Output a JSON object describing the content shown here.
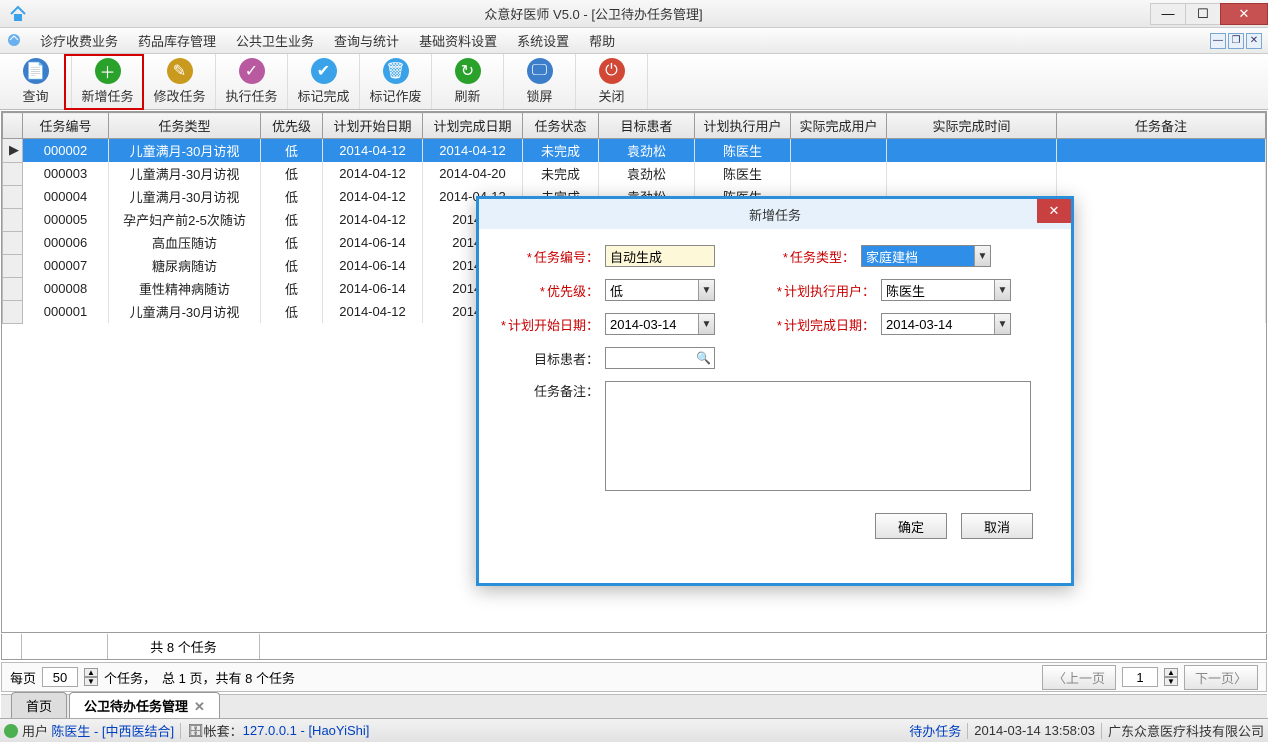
{
  "titlebar": {
    "title": "众意好医师 V5.0 - [公卫待办任务管理]"
  },
  "menubar": {
    "items": [
      "诊疗收费业务",
      "药品库存管理",
      "公共卫生业务",
      "查询与统计",
      "基础资料设置",
      "系统设置",
      "帮助"
    ]
  },
  "toolbar": {
    "items": [
      {
        "label": "查询",
        "color": "#3d7ecb",
        "glyph": "📄"
      },
      {
        "label": "新增任务",
        "color": "#2aa12a",
        "glyph": "＋"
      },
      {
        "label": "修改任务",
        "color": "#c99a1e",
        "glyph": "✎"
      },
      {
        "label": "执行任务",
        "color": "#b95aa0",
        "glyph": "✓"
      },
      {
        "label": "标记完成",
        "color": "#3aa2e8",
        "glyph": "✔"
      },
      {
        "label": "标记作废",
        "color": "#3aa2e8",
        "glyph": "🗑"
      },
      {
        "label": "刷新",
        "color": "#2aa12a",
        "glyph": "↻"
      },
      {
        "label": "锁屏",
        "color": "#3d7ecb",
        "glyph": "🖵"
      },
      {
        "label": "关闭",
        "color": "#d14836",
        "glyph": "⏻"
      }
    ]
  },
  "table": {
    "headers": [
      "",
      "任务编号",
      "任务类型",
      "优先级",
      "计划开始日期",
      "计划完成日期",
      "任务状态",
      "目标患者",
      "计划执行用户",
      "实际完成用户",
      "实际完成时间",
      "任务备注"
    ],
    "rows": [
      {
        "mark": "▶",
        "id": "000002",
        "type": "儿童满月-30月访视",
        "pri": "低",
        "start": "2014-04-12",
        "end": "2014-04-12",
        "status": "未完成",
        "patient": "袁劲松",
        "user": "陈医生",
        "selected": true
      },
      {
        "id": "000003",
        "type": "儿童满月-30月访视",
        "pri": "低",
        "start": "2014-04-12",
        "end": "2014-04-20",
        "status": "未完成",
        "patient": "袁劲松",
        "user": "陈医生"
      },
      {
        "id": "000004",
        "type": "儿童满月-30月访视",
        "pri": "低",
        "start": "2014-04-12",
        "end": "2014-04-12",
        "status": "未完成",
        "patient": "袁劲松",
        "user": "陈医生"
      },
      {
        "id": "000005",
        "type": "孕产妇产前2-5次随访",
        "pri": "低",
        "start": "2014-04-12",
        "end": "2014-0"
      },
      {
        "id": "000006",
        "type": "高血压随访",
        "pri": "低",
        "start": "2014-06-14",
        "end": "2014-0"
      },
      {
        "id": "000007",
        "type": "糖尿病随访",
        "pri": "低",
        "start": "2014-06-14",
        "end": "2014-0"
      },
      {
        "id": "000008",
        "type": "重性精神病随访",
        "pri": "低",
        "start": "2014-06-14",
        "end": "2014-0"
      },
      {
        "id": "000001",
        "type": "儿童满月-30月访视",
        "pri": "低",
        "start": "2014-04-12",
        "end": "2014-0",
        "link": true
      }
    ],
    "count_label": "共 8 个任务"
  },
  "pagebar": {
    "each_label": "每页",
    "per_page": "50",
    "items_label": "个任务，",
    "summary": "总 1 页，共有 8 个任务",
    "prev": "〈上一页",
    "page": "1",
    "next": "下一页〉"
  },
  "tabs": {
    "home": "首页",
    "active": "公卫待办任务管理"
  },
  "statusbar": {
    "user_label": "用户",
    "user": "陈医生 - [中西医结合]",
    "acct_label": "帐套：",
    "acct": "127.0.0.1 - [HaoYiShi]",
    "pending": "待办任务",
    "timestamp": "2014-03-14 13:58:03",
    "company": "广东众意医疗科技有限公司"
  },
  "dialog": {
    "title": "新增任务",
    "labels": {
      "taskno": "任务编号：",
      "tasktype": "任务类型：",
      "priority": "优先级：",
      "planuser": "计划执行用户：",
      "start": "计划开始日期：",
      "end": "计划完成日期：",
      "patient": "目标患者：",
      "remark": "任务备注："
    },
    "values": {
      "taskno": "自动生成",
      "tasktype": "家庭建档",
      "priority": "低",
      "planuser": "陈医生",
      "start": "2014-03-14",
      "end": "2014-03-14"
    },
    "buttons": {
      "ok": "确定",
      "cancel": "取消"
    }
  }
}
